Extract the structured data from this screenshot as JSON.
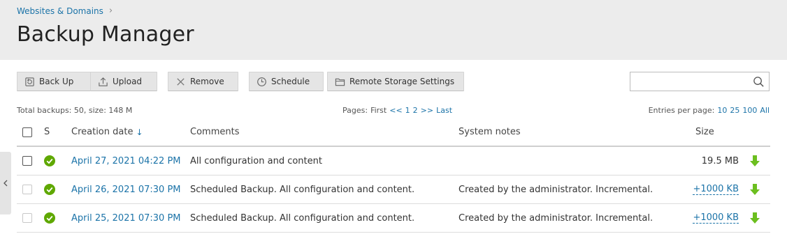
{
  "breadcrumb": {
    "item": "Websites & Domains",
    "separator": "›"
  },
  "page": {
    "title": "Backup Manager"
  },
  "toolbar": {
    "backup": "Back Up",
    "upload": "Upload",
    "remove": "Remove",
    "schedule": "Schedule",
    "remote": "Remote Storage Settings"
  },
  "search": {
    "placeholder": "",
    "value": ""
  },
  "summary": "Total backups: 50, size: 148 M",
  "pager": {
    "prefix": "Pages:",
    "first": "First",
    "prev": "<<",
    "pages": [
      "1",
      "2"
    ],
    "next": ">>",
    "last": "Last"
  },
  "perpage": {
    "label": "Entries per page:",
    "options": [
      "10",
      "25",
      "100",
      "All"
    ]
  },
  "table": {
    "columns": {
      "s": "S",
      "date": "Creation date",
      "sort_indicator": "↓",
      "comments": "Comments",
      "notes": "System notes",
      "size": "Size"
    },
    "rows": [
      {
        "status": "ok",
        "date": "April 27, 2021 04:22 PM",
        "comment": "All configuration and content",
        "notes": "",
        "size": "19.5 MB",
        "size_link": false,
        "checkbox_enabled": true
      },
      {
        "status": "ok",
        "date": "April 26, 2021 07:30 PM",
        "comment": "Scheduled Backup. All configuration and content.",
        "notes": "Created by the administrator. Incremental.",
        "size": "+1000 KB",
        "size_link": true,
        "checkbox_enabled": false
      },
      {
        "status": "ok",
        "date": "April 25, 2021 07:30 PM",
        "comment": "Scheduled Backup. All configuration and content.",
        "notes": "Created by the administrator. Incremental.",
        "size": "+1000 KB",
        "size_link": true,
        "checkbox_enabled": false
      }
    ]
  },
  "colors": {
    "link": "#1b73a8",
    "ok": "#5fa800",
    "download": "#6cbf1f",
    "header_bg": "#ececec"
  }
}
